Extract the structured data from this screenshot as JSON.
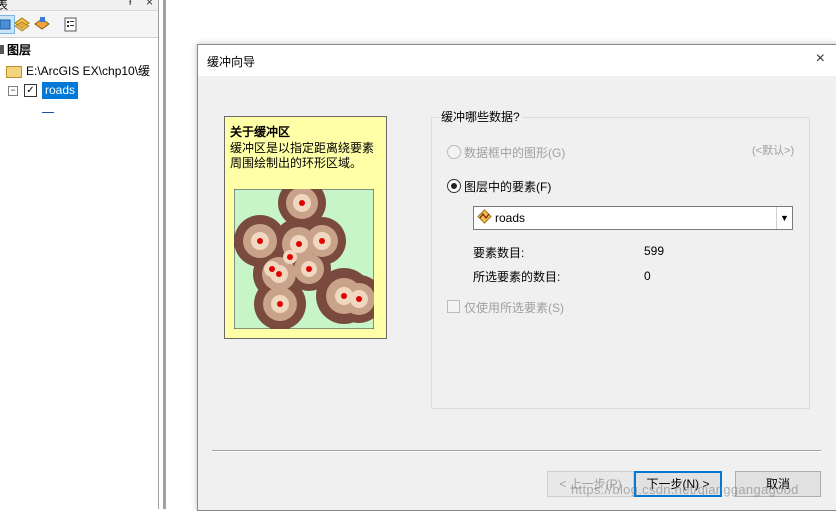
{
  "toc": {
    "title": "表",
    "pin": "ᵼ",
    "close": "×",
    "layers_root": "图层",
    "folder_path": "E:\\ArcGIS EX\\chp10\\缓",
    "layer_name": "roads",
    "expander": "⊟",
    "check": "✓"
  },
  "dialog": {
    "title": "缓冲向导",
    "close": "×",
    "help": {
      "title": "关于缓冲区",
      "description": "缓冲区是以指定距离绕要素周围绘制出的环形区域。"
    },
    "group_label": "缓冲哪些数据?",
    "option_graphics": "数据框中的图形(G)",
    "default_hint": "(<默认>)",
    "option_layer": "图层中的要素(F)",
    "layer_dropdown": "roads",
    "feature_count_label": "要素数目:",
    "feature_count": "599",
    "selected_count_label": "所选要素的数目:",
    "selected_count": "0",
    "use_selected": "仅使用所选要素(S)",
    "back_button": "< 上一步(P)",
    "next_button": "下一步(N) >",
    "cancel_button": "取消"
  },
  "watermark": "https://blog.csdn.net/qianggangagood",
  "colors": {
    "help_bg": "#ffffa8",
    "selection": "#0078d7",
    "buffer_outer": "#7a4a3e",
    "buffer_inner": "#c8a38a",
    "buffer_core": "#f0d7c0",
    "point": "#e00000",
    "map_bg": "#c8f5c8"
  }
}
